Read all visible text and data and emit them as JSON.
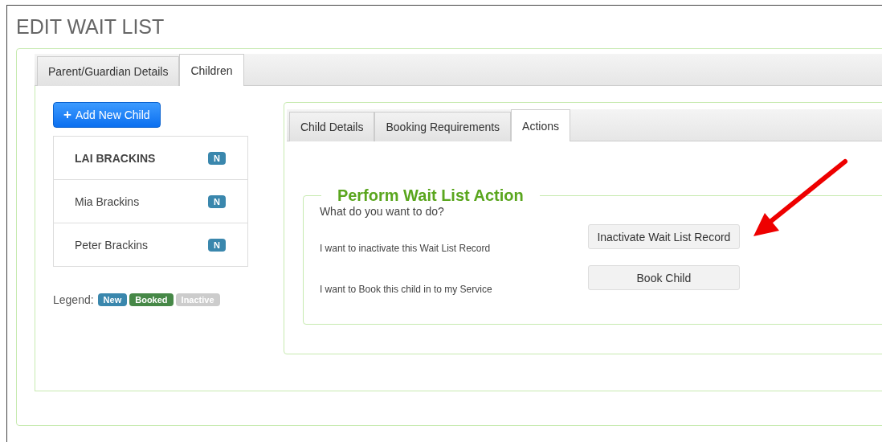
{
  "title": "EDIT WAIT LIST",
  "tabs": [
    {
      "label": "Parent/Guardian Details",
      "selected": false
    },
    {
      "label": "Children",
      "selected": true
    }
  ],
  "add_button": {
    "icon": "+",
    "label": "Add New Child"
  },
  "children": [
    {
      "name": "LAI BRACKINS",
      "badge": "N",
      "color": "#3a87ad",
      "selected": true
    },
    {
      "name": "Mia Brackins",
      "badge": "N",
      "color": "#3a87ad",
      "selected": false
    },
    {
      "name": "Peter Brackins",
      "badge": "N",
      "color": "#3a87ad",
      "selected": false
    }
  ],
  "legend": {
    "label": "Legend:",
    "items": [
      {
        "label": "New",
        "color": "#3a87ad"
      },
      {
        "label": "Booked",
        "color": "#468847"
      },
      {
        "label": "Inactive",
        "color": "#cccccc"
      }
    ]
  },
  "child_tabs": [
    {
      "label": "Child Details",
      "selected": false
    },
    {
      "label": "Booking Requirements",
      "selected": false
    },
    {
      "label": "Actions",
      "selected": true
    }
  ],
  "action_panel": {
    "legend": "Perform Wait List Action",
    "question": "What do you want to do?",
    "actions": [
      {
        "text": "I want to inactivate this Wait List Record",
        "button": "Inactivate Wait List Record"
      },
      {
        "text": "I want to Book this child in to my Service",
        "button": "Book Child"
      }
    ]
  }
}
